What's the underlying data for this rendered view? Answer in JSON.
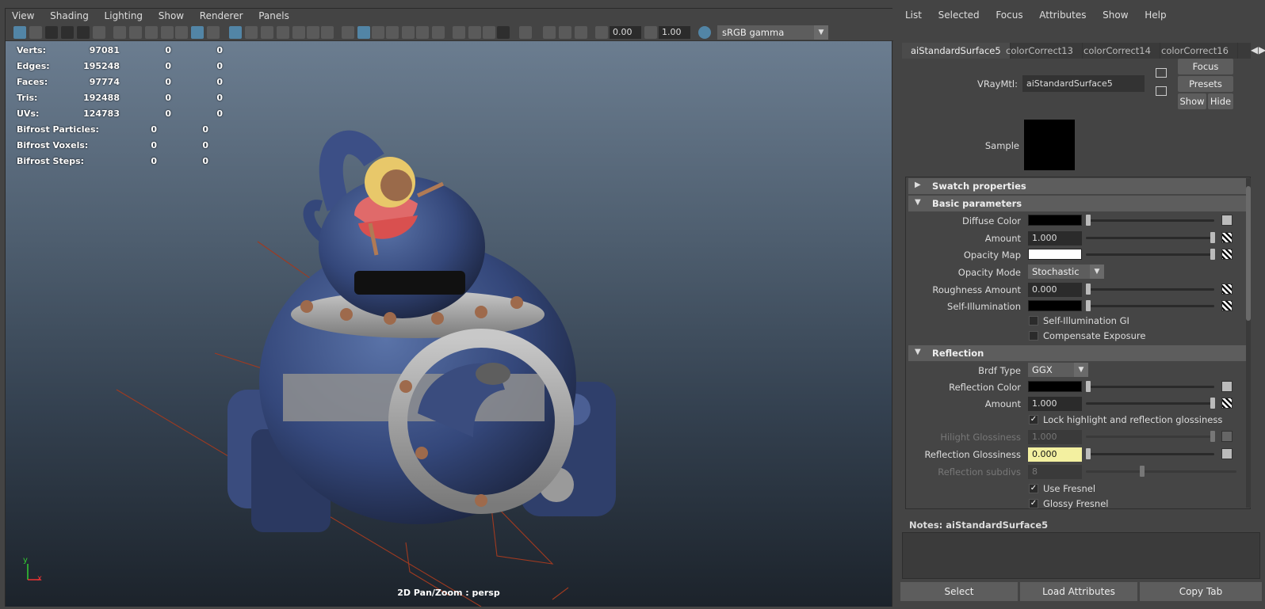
{
  "viewport": {
    "menu": [
      "View",
      "Shading",
      "Lighting",
      "Show",
      "Renderer",
      "Panels"
    ],
    "exposure": "0.00",
    "gamma_value": "1.00",
    "color_space": "sRGB gamma",
    "hud": [
      {
        "label": "Verts:",
        "a": "97081",
        "b": "0",
        "c": "0"
      },
      {
        "label": "Edges:",
        "a": "195248",
        "b": "0",
        "c": "0"
      },
      {
        "label": "Faces:",
        "a": "97774",
        "b": "0",
        "c": "0"
      },
      {
        "label": "Tris:",
        "a": "192488",
        "b": "0",
        "c": "0"
      },
      {
        "label": "UVs:",
        "a": "124783",
        "b": "0",
        "c": "0"
      },
      {
        "label": "Bifrost Particles:",
        "a": "",
        "b": "0",
        "c": "0"
      },
      {
        "label": "Bifrost Voxels:",
        "a": "",
        "b": "0",
        "c": "0"
      },
      {
        "label": "Bifrost Steps:",
        "a": "",
        "b": "0",
        "c": "0"
      }
    ],
    "caption": "2D Pan/Zoom : persp",
    "axis_y": "y",
    "axis_x": "x"
  },
  "attr_editor": {
    "menu": [
      "List",
      "Selected",
      "Focus",
      "Attributes",
      "Show",
      "Help"
    ],
    "tabs": [
      "aiStandardSurface5",
      "colorCorrect13",
      "colorCorrect14",
      "colorCorrect16"
    ],
    "material_label": "VRayMtl:",
    "material_name": "aiStandardSurface5",
    "buttons": {
      "focus": "Focus",
      "presets": "Presets",
      "show": "Show",
      "hide": "Hide"
    },
    "sample_label": "Sample",
    "sections": {
      "swatch": "Swatch properties",
      "basic": "Basic parameters",
      "reflection": "Reflection"
    },
    "basic": {
      "diffuse_color": "Diffuse Color",
      "amount": "Amount",
      "amount_value": "1.000",
      "opacity_map": "Opacity Map",
      "opacity_mode": "Opacity Mode",
      "opacity_mode_value": "Stochastic",
      "roughness": "Roughness Amount",
      "roughness_value": "0.000",
      "self_illum": "Self-Illumination",
      "self_illum_gi": "Self-Illumination GI",
      "compensate": "Compensate Exposure"
    },
    "reflection": {
      "brdf": "Brdf Type",
      "brdf_value": "GGX",
      "refl_color": "Reflection Color",
      "amount": "Amount",
      "amount_value": "1.000",
      "lock": "Lock highlight and reflection glossiness",
      "hilight": "Hilight Glossiness",
      "hilight_value": "1.000",
      "refl_gloss": "Reflection Glossiness",
      "refl_gloss_value": "0.000",
      "subdivs": "Reflection subdivs",
      "subdivs_value": "8",
      "fresnel": "Use Fresnel",
      "glossy_fresnel": "Glossy Fresnel"
    },
    "notes_label": "Notes:",
    "notes_name": "aiStandardSurface5",
    "bottom": {
      "select": "Select",
      "load": "Load Attributes",
      "copy": "Copy Tab"
    }
  }
}
